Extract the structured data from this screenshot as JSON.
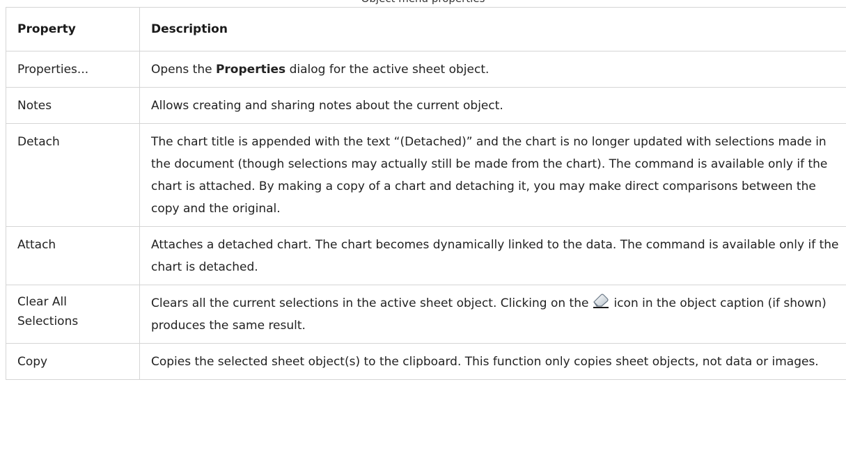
{
  "caption": "Object menu properties",
  "table": {
    "headers": {
      "property": "Property",
      "description": "Description"
    },
    "rows": [
      {
        "property": "Properties...",
        "description_pre": "Opens the ",
        "description_bold": "Properties",
        "description_post": " dialog for the active sheet object."
      },
      {
        "property": "Notes",
        "description": "Allows creating and sharing notes about the current object."
      },
      {
        "property": "Detach",
        "description": "The chart title is appended with the text “(Detached)” and the chart is no longer updated with selections made in the document (though selections may actually still be made from the chart). The command is available only if the chart is attached. By making a copy of a chart and detaching it, you may make direct comparisons between the copy and the original."
      },
      {
        "property": "Attach",
        "description": "Attaches a detached chart. The chart becomes dynamically linked to the data. The command is available only if the chart is detached."
      },
      {
        "property": "Clear All Selections",
        "description_pre": "Clears all the current selections in the active sheet object. Clicking on the",
        "icon": "eraser-icon",
        "description_post": "icon in the object caption (if shown) produces the same result."
      },
      {
        "property": "Copy",
        "description": "Copies the selected sheet object(s) to the clipboard. This function only copies sheet objects, not data or images."
      }
    ]
  }
}
